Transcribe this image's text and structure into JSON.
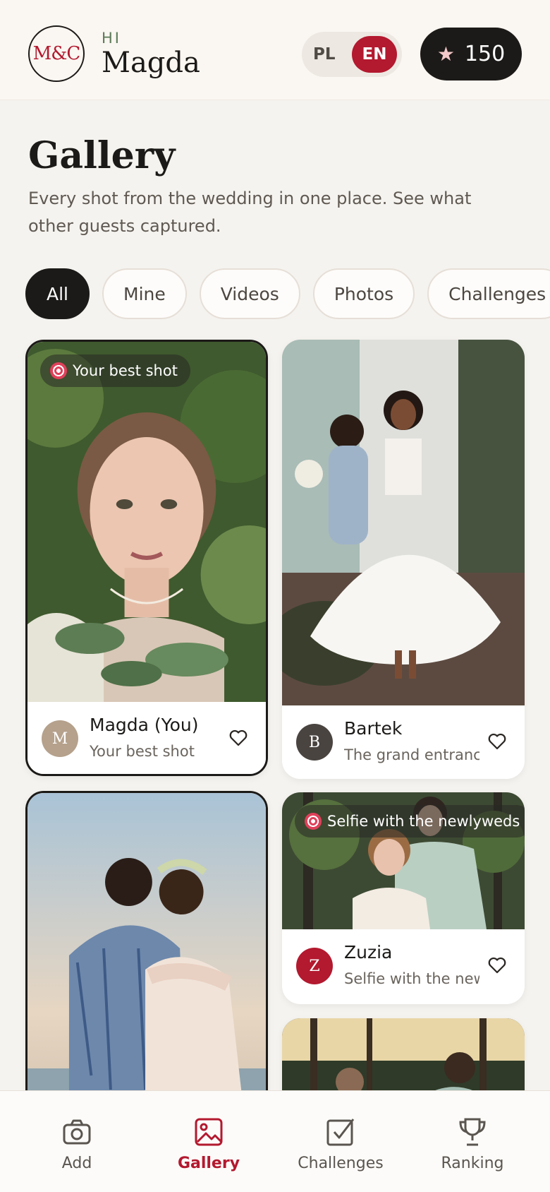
{
  "header": {
    "logo_text": "M&C",
    "greeting": "HI",
    "user_name": "Magda",
    "lang_options": [
      "PL",
      "EN"
    ],
    "lang_selected": "EN",
    "points": "150"
  },
  "page": {
    "title": "Gallery",
    "subtitle": "Every shot from the wedding in one place. See what other guests captured."
  },
  "filters": [
    "All",
    "Mine",
    "Videos",
    "Photos",
    "Challenges"
  ],
  "filter_selected": "All",
  "cards": [
    {
      "badge": "Your best shot",
      "avatar_letter": "M",
      "author": "Magda (You)",
      "caption": "Your best shot",
      "avatar_color": "#b5a18c"
    },
    {
      "badge": "",
      "avatar_letter": "B",
      "author": "Bartek",
      "caption": "The grand entrance",
      "avatar_color": "#4a4440"
    },
    {
      "badge": "Selfie with the newlyweds",
      "avatar_letter": "Z",
      "author": "Zuzia",
      "caption": "Selfie with the newlyweds",
      "avatar_color": "#b3192f"
    }
  ],
  "nav": [
    {
      "label": "Add",
      "icon": "camera-icon"
    },
    {
      "label": "Gallery",
      "icon": "image-icon"
    },
    {
      "label": "Challenges",
      "icon": "checkbox-icon"
    },
    {
      "label": "Ranking",
      "icon": "trophy-icon"
    }
  ],
  "nav_selected": "Gallery",
  "colors": {
    "accent": "#b3192f",
    "dark": "#1c1a18",
    "background": "#f5f3ef"
  }
}
